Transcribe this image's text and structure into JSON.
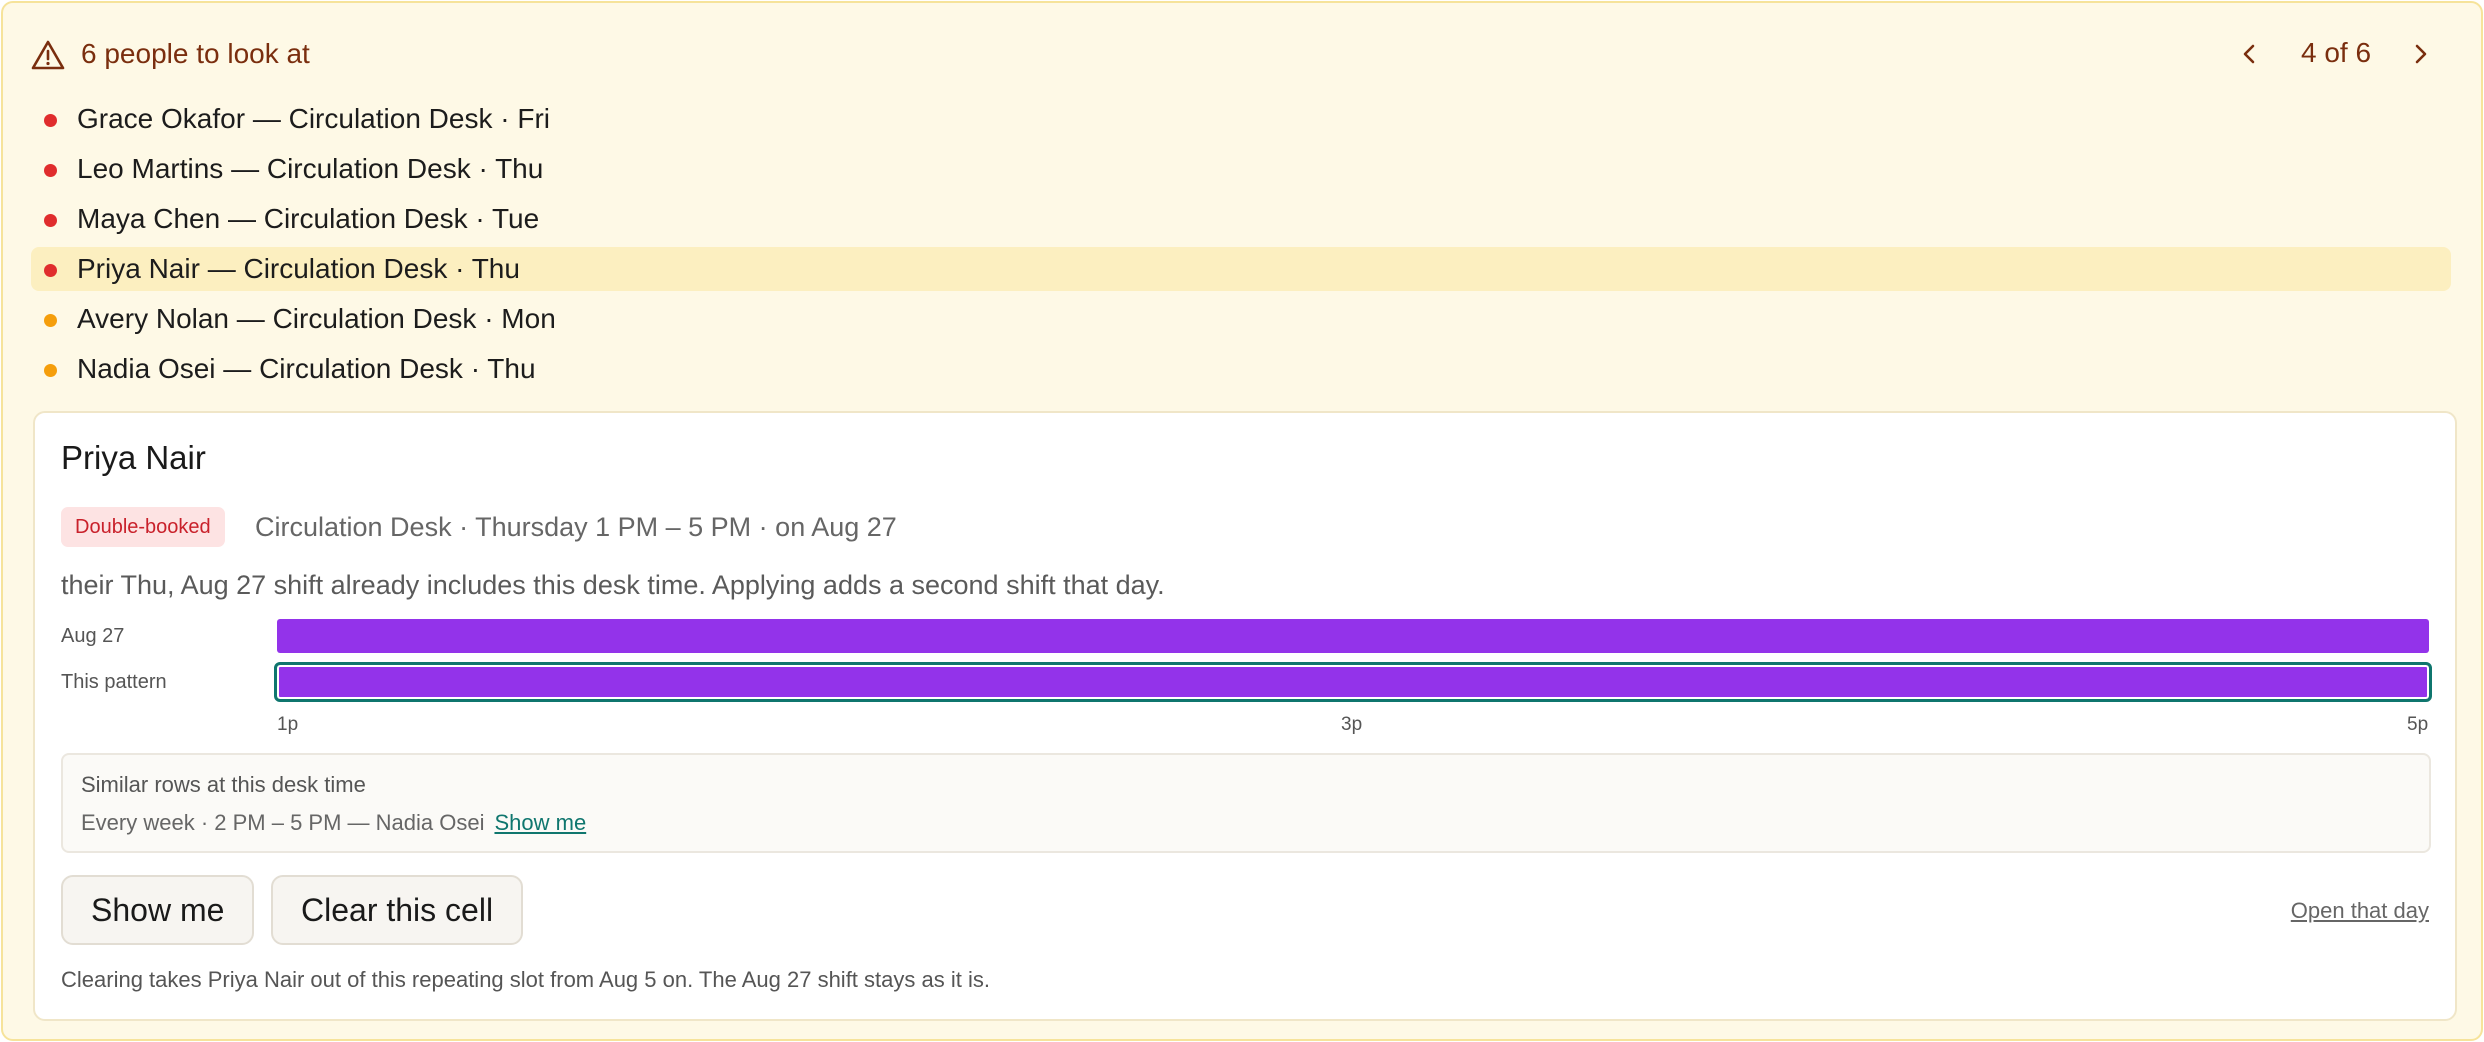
{
  "header": {
    "title": "6 people to look at",
    "pager": "4 of 6",
    "icon": "warning-triangle-icon"
  },
  "people": [
    {
      "label": "Grace Okafor — Circulation Desk · Fri",
      "severity": "red",
      "color": "#e02d2d"
    },
    {
      "label": "Leo Martins — Circulation Desk · Thu",
      "severity": "red",
      "color": "#e02d2d"
    },
    {
      "label": "Maya Chen — Circulation Desk · Tue",
      "severity": "red",
      "color": "#e02d2d"
    },
    {
      "label": "Priya Nair — Circulation Desk · Thu",
      "severity": "red",
      "color": "#e02d2d",
      "selected": true
    },
    {
      "label": "Avery Nolan — Circulation Desk · Mon",
      "severity": "amber",
      "color": "#f59e0b"
    },
    {
      "label": "Nadia Osei — Circulation Desk · Thu",
      "severity": "amber",
      "color": "#f59e0b"
    }
  ],
  "detail": {
    "name": "Priya Nair",
    "badge": "Double-booked",
    "meta": "Circulation Desk · Thursday 1 PM – 5 PM · on Aug 27",
    "description": "their Thu, Aug 27 shift already includes this desk time. Applying adds a second shift that day.",
    "timeline": {
      "rows": [
        {
          "label": "Aug 27"
        },
        {
          "label": "This pattern"
        }
      ],
      "ticks": [
        "1p",
        "3p",
        "5p"
      ],
      "bar_color": "#9333ea"
    },
    "similar": {
      "title": "Similar rows at this desk time",
      "row": "Every week · 2 PM – 5 PM — Nadia Osei",
      "link": "Show me"
    },
    "buttons": {
      "show_me": "Show me",
      "clear": "Clear this cell",
      "open_day": "Open that day"
    },
    "footnote": "Clearing takes Priya Nair out of this repeating slot from Aug 5 on. The Aug 27 shift stays as it is."
  }
}
